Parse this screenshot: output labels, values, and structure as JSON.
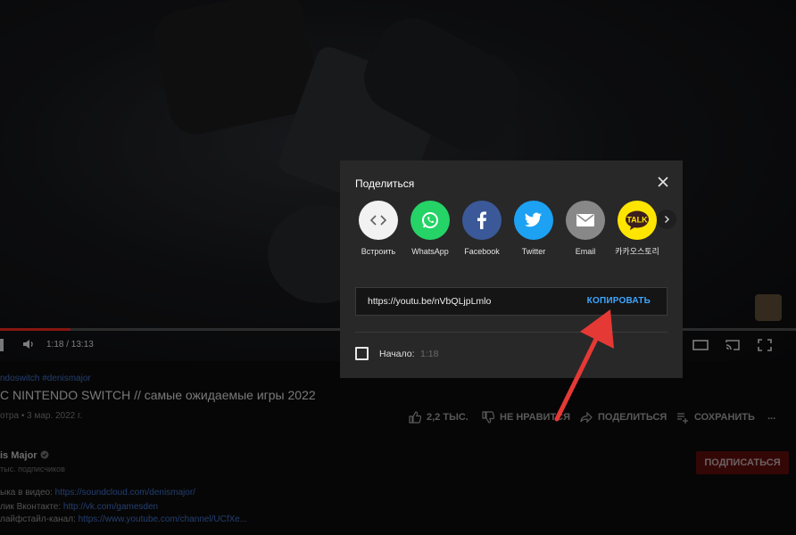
{
  "player": {
    "time": "1:18 / 13:13",
    "progress_fraction": 0.089
  },
  "video": {
    "hashtags": "ndoswitch #denismajor",
    "title": "C NINTENDO SWITCH // самые ожидаемые игры 2022",
    "views": "отра • 3 мар. 2022 г.",
    "likes": "2,2 ТЫС.",
    "dislike": "НЕ НРАВИТСЯ",
    "share": "ПОДЕЛИТЬСЯ",
    "save": "СОХРАНИТЬ",
    "more": "..."
  },
  "channel": {
    "name": "is Major",
    "subs": "тыс. подписчиков",
    "subscribe": "ПОДПИСАТЬСЯ"
  },
  "description": [
    {
      "prefix": "ыка в видео: ",
      "link": "https://soundcloud.com/denismajor/"
    },
    {
      "prefix": "лик Вконтакте: ",
      "link": "http://vk.com/gamesden"
    },
    {
      "prefix": "лайфстайл-канал: ",
      "link": "https://www.youtube.com/channel/UCfXe..."
    }
  ],
  "share_dialog": {
    "title": "Поделиться",
    "items": [
      {
        "label": "Встроить",
        "icon": "embed-icon",
        "color": "#f2f2f2"
      },
      {
        "label": "WhatsApp",
        "icon": "whatsapp-icon",
        "color": "#25d366"
      },
      {
        "label": "Facebook",
        "icon": "facebook-icon",
        "color": "#3b5998"
      },
      {
        "label": "Twitter",
        "icon": "twitter-icon",
        "color": "#1da1f2"
      },
      {
        "label": "Email",
        "icon": "email-icon",
        "color": "#888888"
      },
      {
        "label": "카카오스토리",
        "icon": "kakaotalk-icon",
        "color": "#fee500"
      }
    ],
    "url": "https://youtu.be/nVbQLjpLmlo",
    "copy_label": "КОПИРОВАТЬ",
    "start_label": "Начало:",
    "start_time": "1:18"
  },
  "colors": {
    "accent_blue": "#3ea6ff",
    "annotation_arrow": "#e53935",
    "subscribe_red": "#5a0d0d"
  }
}
